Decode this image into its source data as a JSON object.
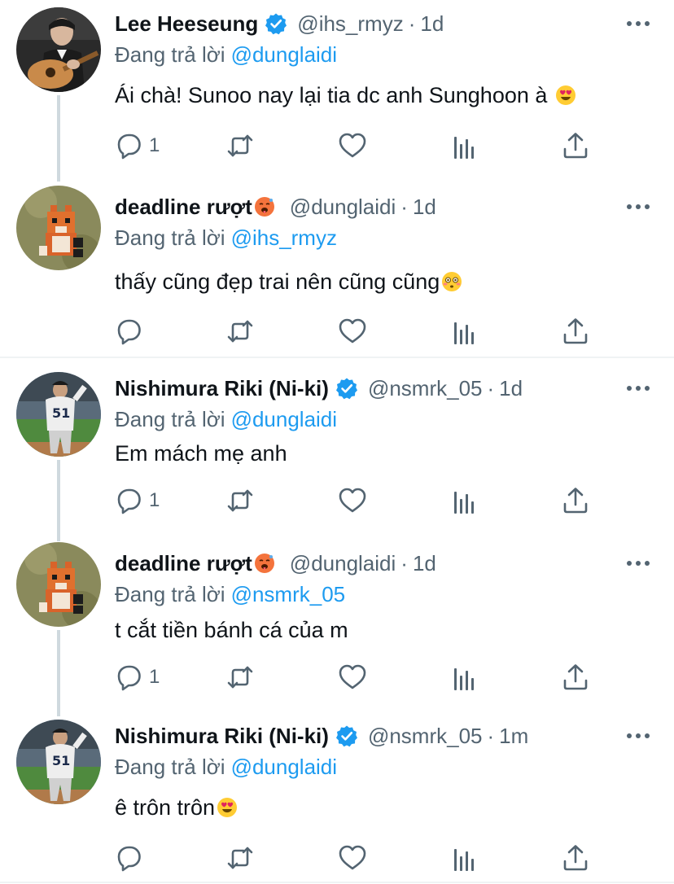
{
  "colors": {
    "link": "#1d9bf0",
    "secondary": "#536471",
    "text": "#0f1419",
    "verified": "#1d9bf0"
  },
  "tweets": [
    {
      "name": "Lee Heeseung",
      "verified": true,
      "handle": "@ihs_rmyz",
      "time": "1d",
      "replying_label": "Đang trả lời",
      "replying_to": "@dunglaidi",
      "text": "Ái chà! Sunoo nay lại tia dc anh Sunghoon à",
      "text_emoji": "heart-eyes-emoji",
      "reply_count": "1",
      "avatar": "guitar-player-avatar"
    },
    {
      "name": "deadline rượt",
      "name_emoji": "hot-face-emoji",
      "handle": "@dunglaidi",
      "time": "1d",
      "replying_label": "Đang trả lời",
      "replying_to": "@ihs_rmyz",
      "text": "thấy cũng đẹp trai nên cũng cũng",
      "text_emoji": "flushed-face-emoji",
      "reply_count": "",
      "avatar": "pixel-fox-avatar"
    },
    {
      "name": "Nishimura Riki (Ni-ki)",
      "verified": true,
      "handle": "@nsmrk_05",
      "time": "1d",
      "replying_label": "Đang trả lời",
      "replying_to": "@dunglaidi",
      "text": "Em mách mẹ anh",
      "reply_count": "1",
      "avatar": "baseball-player-avatar"
    },
    {
      "name": "deadline rượt",
      "name_emoji": "hot-face-emoji",
      "handle": "@dunglaidi",
      "time": "1d",
      "replying_label": "Đang trả lời",
      "replying_to": "@nsmrk_05",
      "text": "t cắt tiền bánh cá của m",
      "reply_count": "1",
      "avatar": "pixel-fox-avatar"
    },
    {
      "name": "Nishimura Riki (Ni-ki)",
      "verified": true,
      "handle": "@nsmrk_05",
      "time": "1m",
      "replying_label": "Đang trả lời",
      "replying_to": "@dunglaidi",
      "text": "ê trôn trôn",
      "text_emoji": "heart-eyes-emoji",
      "reply_count": "",
      "avatar": "baseball-player-avatar"
    }
  ]
}
